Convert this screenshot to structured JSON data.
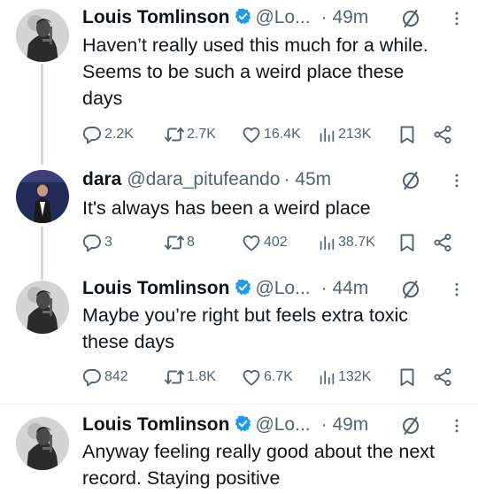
{
  "tweets": [
    {
      "name": "Louis Tomlinson",
      "verified": true,
      "handle": "@Lo...",
      "time": "· 49m",
      "text": "Haven’t really used this much for a while.\nSeems to be such a weird place these\ndays",
      "replies": "2.2K",
      "retweets": "2.7K",
      "likes": "16.4K",
      "views": "213K"
    },
    {
      "name": "dara",
      "verified": false,
      "handle": "@dara_pitufeando",
      "time": "· 45m",
      "text": "It's always has been a weird place",
      "replies": "3",
      "retweets": "8",
      "likes": "402",
      "views": "38.7K"
    },
    {
      "name": "Louis Tomlinson",
      "verified": true,
      "handle": "@Lo...",
      "time": "· 44m",
      "text": "Maybe you’re right but feels extra toxic\nthese days",
      "replies": "842",
      "retweets": "1.8K",
      "likes": "6.7K",
      "views": "132K"
    },
    {
      "name": "Louis Tomlinson",
      "verified": true,
      "handle": "@Lo...",
      "time": "· 49m",
      "text": "Anyway feeling really good about the next\nrecord. Staying positive"
    }
  ],
  "colors": {
    "text": "#0f1419",
    "muted": "#536471",
    "verified": "#1d9bf0",
    "thread_line": "#cfd9de"
  },
  "icons": [
    "reply-icon",
    "retweet-icon",
    "like-icon",
    "views-icon",
    "bookmark-icon",
    "share-icon",
    "verified-badge-icon",
    "no-entry-icon",
    "more-icon"
  ]
}
